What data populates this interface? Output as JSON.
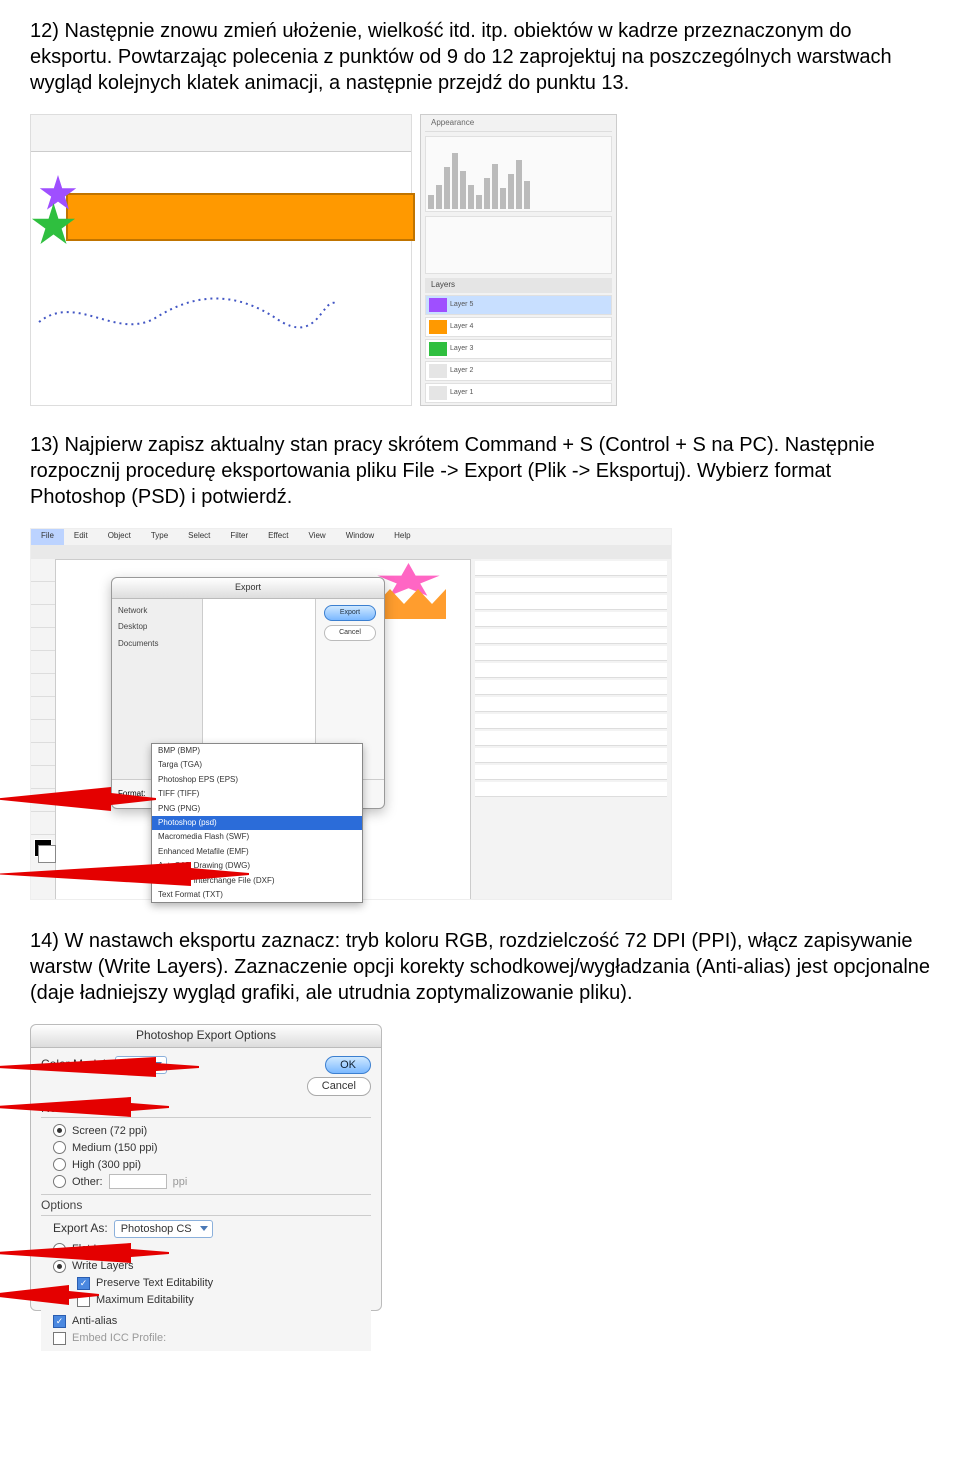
{
  "para1": "12) Następnie znowu zmień ułożenie, wielkość itd. itp. obiektów w kadrze przeznaczonym do eksportu. Powtarzając polecenia z punktów od 9 do 12 zaprojektuj na poszczególnych warstwach wygląd kolejnych klatek animacji, a następnie przejdź do punktu 13.",
  "para2": "13) Najpierw zapisz aktualny stan pracy skrótem Command + S (Control + S na PC). Następnie rozpocznij procedurę eksportowania pliku File -> Export (Plik -> Eksportuj). Wybierz format Photoshop (PSD) i potwierdź.",
  "para3": "14) W nastawch eksportu zaznacz: tryb koloru RGB, rozdzielczość 72 DPI (PPI), włącz zapisywanie warstw (Write Layers). Zaznaczenie opcji korekty schodkowej/wygładzania (Anti-alias) jest opcjonalne (daje ładniejszy wygląd grafiki, ale utrudnia zoptymalizowanie pliku).",
  "fig1": {
    "layers_head": "Layers",
    "layers": [
      "Layer 5",
      "Layer 4",
      "Layer 3",
      "Layer 2",
      "Layer 1"
    ]
  },
  "fig2": {
    "menu_items": [
      "File",
      "Edit",
      "Object",
      "Type",
      "Select",
      "Filter",
      "Effect",
      "View",
      "Window",
      "Help"
    ],
    "dialog_title": "Export",
    "btn_export": "Export",
    "btn_cancel": "Cancel",
    "format_label": "Format:",
    "format_value": "Photoshop (psd)",
    "options": [
      "BMP (BMP)",
      "Targa (TGA)",
      "Photoshop EPS (EPS)",
      "TIFF (TIFF)",
      "PNG (PNG)",
      "Photoshop (psd)",
      "Macromedia Flash (SWF)",
      "Enhanced Metafile (EMF)",
      "AutoCAD Drawing (DWG)",
      "AutoCAD Interchange File (DXF)",
      "Text Format (TXT)"
    ],
    "option_selected_index": 5
  },
  "fig3": {
    "title": "Photoshop Export Options",
    "color_model_label": "Color Model:",
    "color_model_value": "RGB",
    "ok": "OK",
    "cancel": "Cancel",
    "resolution_label": "Resolution",
    "res_screen": "Screen (72 ppi)",
    "res_medium": "Medium (150 ppi)",
    "res_high": "High (300 ppi)",
    "res_other": "Other:",
    "res_other_unit": "ppi",
    "options_label": "Options",
    "export_as_label": "Export As:",
    "export_as_value": "Photoshop CS",
    "flat": "Flat Image",
    "write_layers": "Write Layers",
    "preserve_text": "Preserve Text Editability",
    "max_edit": "Maximum Editability",
    "anti_alias": "Anti-alias",
    "icc": "Embed ICC Profile:"
  }
}
